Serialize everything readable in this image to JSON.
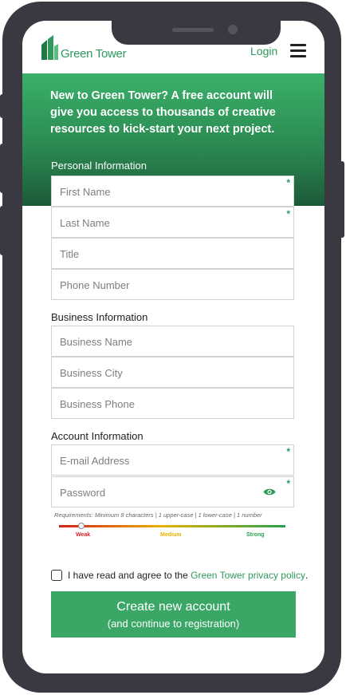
{
  "header": {
    "logo_text": "Green Tower",
    "login_label": "Login",
    "menu_icon": "hamburger-menu-icon"
  },
  "hero": {
    "message": "New to Green Tower? A free account will give you access to thousands of creative resources to kick-start your next project."
  },
  "sections": {
    "personal": "Personal Information",
    "business": "Business Information",
    "account": "Account Information"
  },
  "fields": {
    "first_name": {
      "placeholder": "First Name",
      "required": "*"
    },
    "last_name": {
      "placeholder": "Last Name",
      "required": "*"
    },
    "title": {
      "placeholder": "Title"
    },
    "phone": {
      "placeholder": "Phone Number"
    },
    "business_name": {
      "placeholder": "Business Name"
    },
    "business_city": {
      "placeholder": "Business City"
    },
    "business_phone": {
      "placeholder": "Business Phone"
    },
    "email": {
      "placeholder": "E-mail Address",
      "required": "*"
    },
    "password": {
      "placeholder": "Password",
      "required": "*"
    }
  },
  "password_requirements": "Requirements: Minimum 8 characters  |  1 upper-case  |  1 lower-case  |  1 number",
  "strength_meter": {
    "labels": [
      "Weak",
      "Medium",
      "Strong"
    ],
    "level": 0.1,
    "colors": {
      "weak": "#d62020",
      "medium": "#e8b100",
      "strong": "#27a050"
    }
  },
  "consent": {
    "prefix": "I have read and agree to the ",
    "link": "Green Tower privacy policy",
    "suffix": ".",
    "checked": false
  },
  "submit": {
    "label": "Create new account",
    "sublabel": "(and continue to registration)"
  },
  "colors": {
    "brand": "#2e9a5c",
    "button": "#3aa767",
    "phone_frame": "#3a3941"
  }
}
